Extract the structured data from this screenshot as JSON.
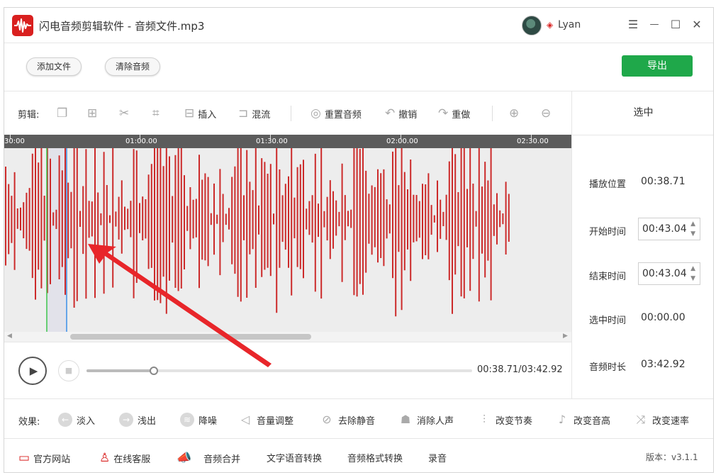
{
  "app": {
    "title": "闪电音频剪辑软件 - 音频文件.mp3",
    "user_name": "Lyan",
    "logo_icon": "waveform-logo-icon",
    "accent": "#d9201f"
  },
  "window_controls": {
    "menu": "☰",
    "minimize": "—",
    "maximize": "☐",
    "close": "✕"
  },
  "actions": {
    "add_file": "添加文件",
    "clear_audio": "清除音频",
    "export": "导出",
    "export_color": "#1fa84a"
  },
  "toolbar": {
    "label": "剪辑:",
    "insert": "插入",
    "mix": "混流",
    "reset": "重置音频",
    "undo": "撤销",
    "redo": "重做"
  },
  "timeline": {
    "ticks": [
      "30:00",
      "01:00.00",
      "01:30.00",
      "02:00.00",
      "02:30.00"
    ]
  },
  "panel": {
    "header": "选中",
    "play_position_label": "播放位置",
    "play_position": "00:38.71",
    "start_label": "开始时间",
    "start_value": "00:43.04",
    "end_label": "结束时间",
    "end_value": "00:43.04",
    "selected_label": "选中时间",
    "selected_value": "00:00.00",
    "duration_label": "音频时长",
    "duration_value": "03:42.92"
  },
  "player": {
    "time_readout": "00:38.71/03:42.92",
    "progress": 0.174
  },
  "effects": {
    "label": "效果:",
    "fade_in": "淡入",
    "fade_out": "浅出",
    "denoise": "降噪",
    "volume": "音量调整",
    "remove_silence": "去除静音",
    "remove_vocals": "消除人声",
    "tempo": "改变节奏",
    "pitch": "改变音高",
    "speed": "改变速率"
  },
  "footer": {
    "website": "官方网站",
    "service": "在线客服",
    "merge": "音频合并",
    "tts": "文字语音转换",
    "format": "音频格式转换",
    "record": "录音",
    "version": "版本：v3.1.1"
  }
}
